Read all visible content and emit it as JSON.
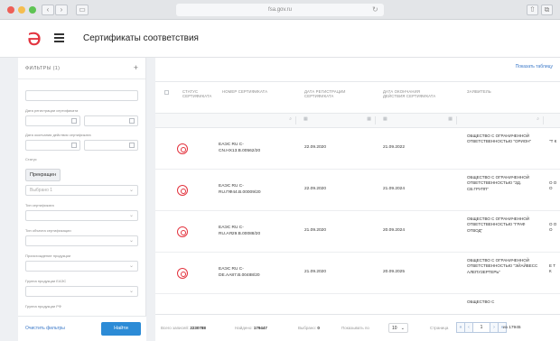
{
  "browser": {
    "url": "fsa.gov.ru",
    "traffic_lights": [
      "#ee5f57",
      "#f5bd4f",
      "#5fc454"
    ]
  },
  "app": {
    "logo_glyph": "ә",
    "page_title": "Сертификаты соответствия",
    "accent_color": "#e3343f",
    "link_color": "#3a78c8"
  },
  "sidebar": {
    "filters_title": "ФИЛЬТРЫ (1)",
    "add_icon": "plus-icon",
    "reg_date_label": "Дата регистрации сертификата",
    "end_date_label": "Дата окончания действия сертификата",
    "status_label": "Статус",
    "status_chip": "Прекращен",
    "status_select_placeholder": "Выбрано 1",
    "labels": [
      "Тип сертификата",
      "Тип объекта сертификации",
      "Происхождение продукции",
      "Группа продукции ЕАЭС",
      "Группа продукции РФ"
    ],
    "reset_label": "Очистить фильтры",
    "find_label": "Найти"
  },
  "table": {
    "export_label": "Показать таблицу",
    "columns": [
      "СТАТУС СЕРТИФИКАТА",
      "НОМЕР СЕРТИФИКАТА",
      "ДАТА РЕГИСТРАЦИИ СЕРТИФИКАТА",
      "ДАТА ОКОНЧАНИЯ ДЕЙСТВИЯ СЕРТИФИКАТА",
      "ЗАЯВИТЕЛЬ"
    ],
    "rows": [
      {
        "number": "ЕАЭС RU С-CN.НХ13.В.00562/20",
        "reg_date": "22.09.2020",
        "end_date": "21.09.2022",
        "applicant": "ОБЩЕСТВО С ОГРАНИЧЕННОЙ ОТВЕТСТВЕННОСТЬЮ \"ОРИОН\"",
        "extra": "\"Т К"
      },
      {
        "number": "ЕАЭС RU С-RU.ПФ44.В.00009/20",
        "reg_date": "22.09.2020",
        "end_date": "21.09.2024",
        "applicant": "ОБЩЕСТВО С ОГРАНИЧЕННОЙ ОТВЕТСТВЕННОСТЬЮ \"ЗД. СВ.ГРУПП\"",
        "extra": "О О О"
      },
      {
        "number": "ЕАЭС RU С-RU.АЯ29.В.00088/20",
        "reg_date": "21.09.2020",
        "end_date": "20.09.2024",
        "applicant": "ОБЩЕСТВО С ОГРАНИЧЕННОЙ ОТВЕТСТВЕННОСТЬЮ \"ГРАФ ОТВОД\"",
        "extra": "О О О"
      },
      {
        "number": "ЕАЭС RU С-DE.АА87.В.00488/20",
        "reg_date": "21.09.2020",
        "end_date": "20.09.2025",
        "applicant": "ОБЩЕСТВО С ОГРАНИЧЕННОЙ ОТВЕТСТВЕННОСТЬЮ \"ЭЙАЙВЕСС АЛЕПУЗЕРТЕРЬ\"",
        "extra": "Е Т К"
      },
      {
        "number": "",
        "reg_date": "",
        "end_date": "",
        "applicant": "ОБЩЕСТВО С",
        "extra": ""
      }
    ]
  },
  "footer": {
    "total_label": "Всего записей:",
    "total": "2230788",
    "found_label": "Найдено:",
    "found": "179447",
    "selected_label": "Выбрано:",
    "selected": "0",
    "perpage_label": "Показывать по",
    "perpage": "10",
    "page_label": "Страница",
    "page": "1",
    "of_pages": "из 17945"
  }
}
